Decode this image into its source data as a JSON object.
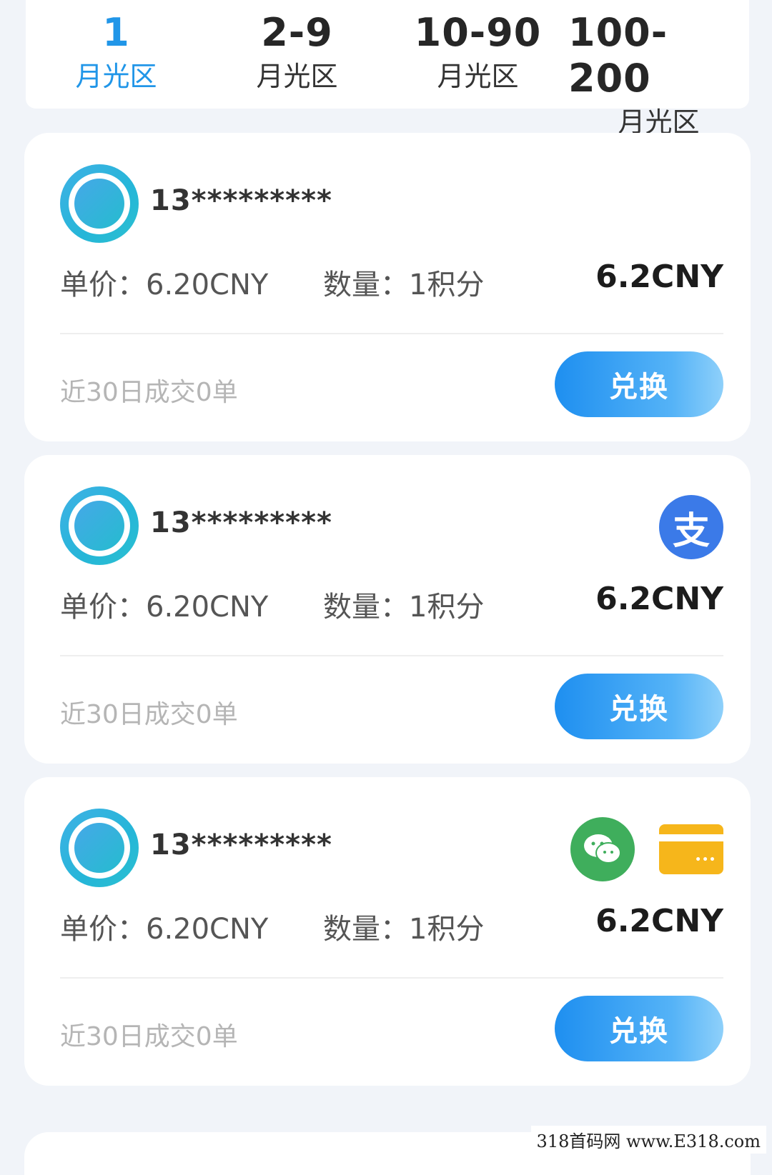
{
  "tabs": [
    {
      "num": "1",
      "sub": "月光区"
    },
    {
      "num": "2-9",
      "sub": "月光区"
    },
    {
      "num": "10-90",
      "sub": "月光区"
    },
    {
      "num": "100-200",
      "sub": "月光区"
    }
  ],
  "listings": [
    {
      "phone": "13*********",
      "price_label": "单价：6.20CNY",
      "qty_label": "数量：1积分",
      "total": "6.2CNY",
      "deals": "近30日成交0单",
      "button": "兑换",
      "payment_icons": []
    },
    {
      "phone": "13*********",
      "price_label": "单价：6.20CNY",
      "qty_label": "数量：1积分",
      "total": "6.2CNY",
      "deals": "近30日成交0单",
      "button": "兑换",
      "payment_icons": [
        "alipay-icon"
      ],
      "alipay_glyph": "支"
    },
    {
      "phone": "13*********",
      "price_label": "单价：6.20CNY",
      "qty_label": "数量：1积分",
      "total": "6.2CNY",
      "deals": "近30日成交0单",
      "button": "兑换",
      "payment_icons": [
        "wechat-icon",
        "bank-card-icon"
      ]
    }
  ],
  "watermark": "318首码网 www.E318.com",
  "colors": {
    "active_tab": "#2196e8",
    "button_gradient_start": "#1e8ff0",
    "button_gradient_end": "#8ed0fa",
    "alipay": "#3b7ae8",
    "wechat": "#3fae5c",
    "bank_card": "#f6b61b"
  }
}
